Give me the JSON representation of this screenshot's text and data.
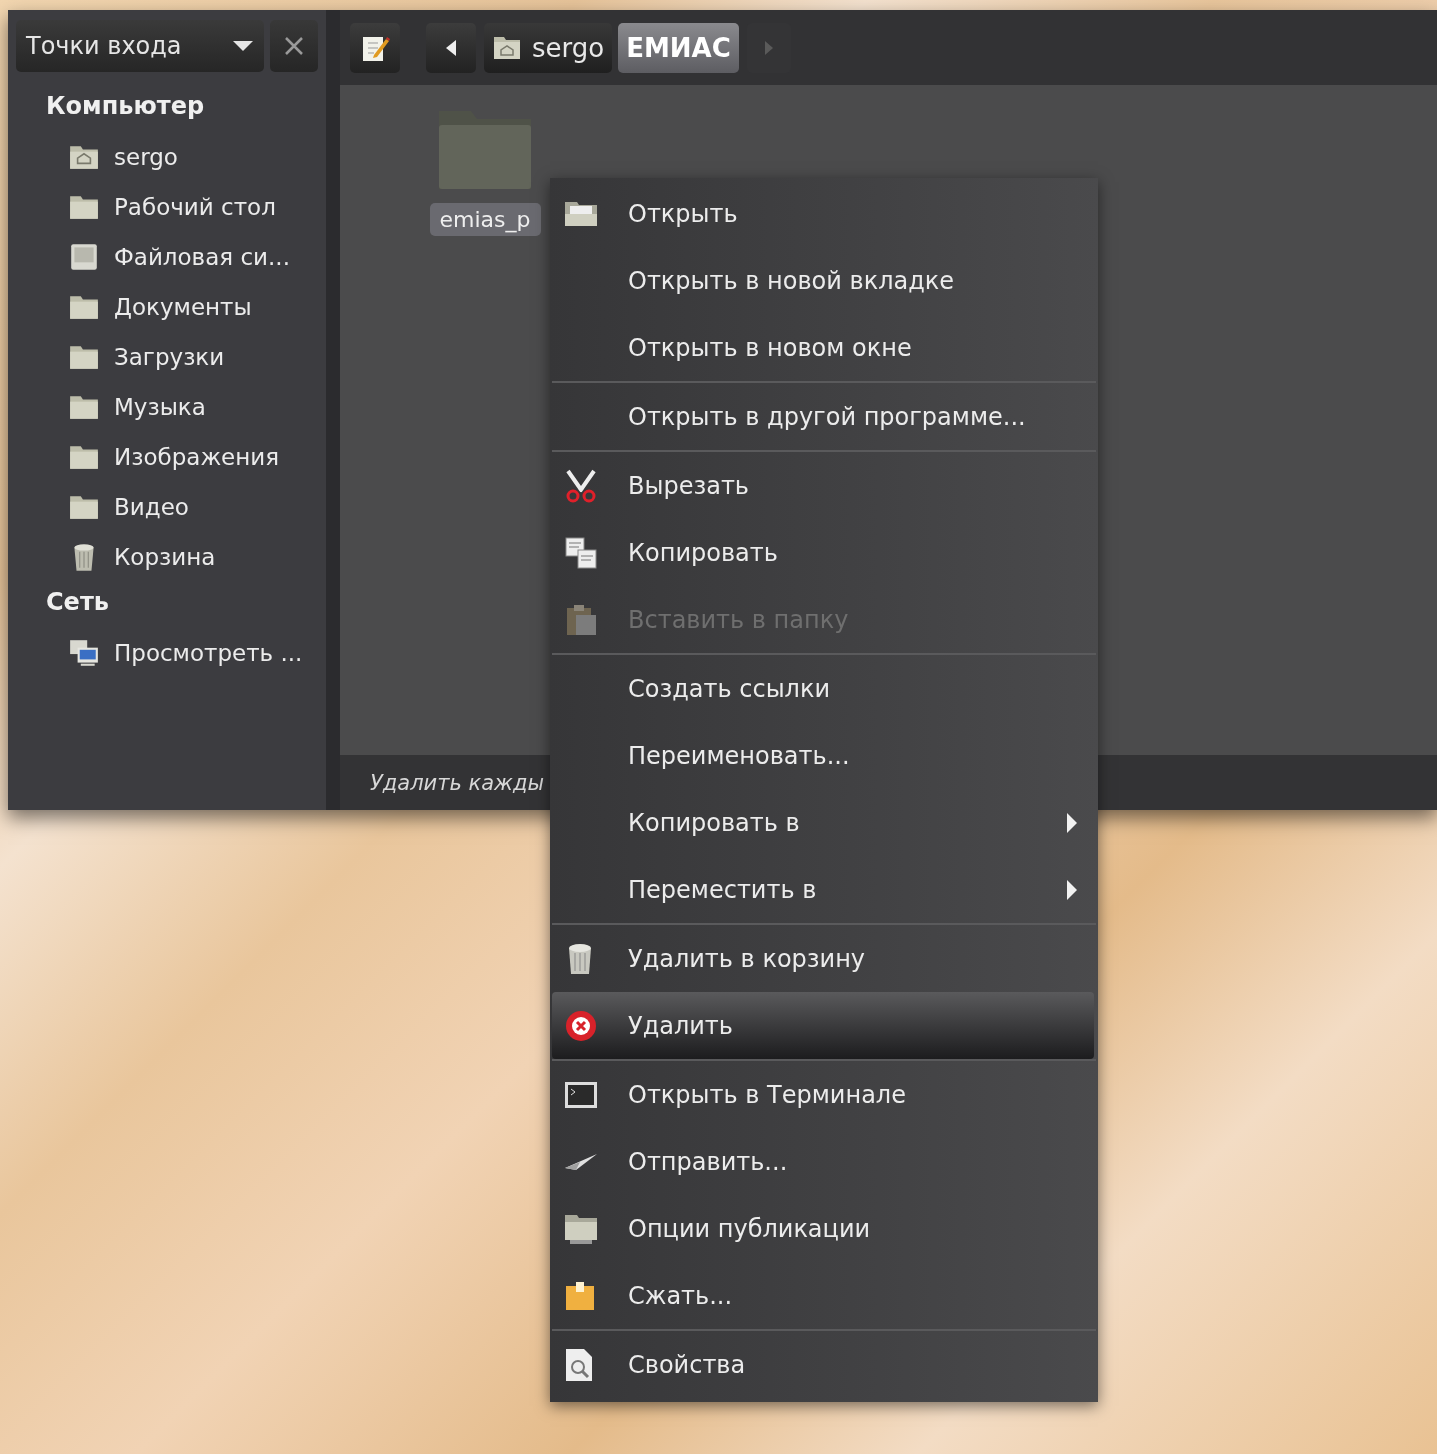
{
  "sidebar": {
    "places_dropdown": {
      "label": "Точки входа"
    },
    "sections": [
      {
        "title": "Компьютер",
        "items": [
          {
            "label": "sergo"
          },
          {
            "label": "Рабочий стол"
          },
          {
            "label": "Файловая си..."
          },
          {
            "label": "Документы"
          },
          {
            "label": "Загрузки"
          },
          {
            "label": "Музыка"
          },
          {
            "label": "Изображения"
          },
          {
            "label": "Видео"
          },
          {
            "label": "Корзина"
          }
        ]
      },
      {
        "title": "Сеть",
        "items": [
          {
            "label": "Просмотреть ..."
          }
        ]
      }
    ]
  },
  "toolbar": {
    "path": [
      {
        "label": "sergo",
        "selected": false
      },
      {
        "label": "ЕМИАС",
        "selected": true
      }
    ],
    "forward_disabled": true
  },
  "files": [
    {
      "name": "emias_p",
      "selected": true
    }
  ],
  "status_bar": {
    "text": "Удалить кажды"
  },
  "context_menu": [
    {
      "kind": "item",
      "label": "Открыть",
      "disabled": false,
      "selected": false,
      "submenu": false
    },
    {
      "kind": "item",
      "label": "Открыть в новой вкладке",
      "disabled": false,
      "selected": false,
      "submenu": false
    },
    {
      "kind": "item",
      "label": "Открыть в новом окне",
      "disabled": false,
      "selected": false,
      "submenu": false
    },
    {
      "kind": "separator"
    },
    {
      "kind": "item",
      "label": "Открыть в другой программе...",
      "disabled": false,
      "selected": false,
      "submenu": false
    },
    {
      "kind": "separator"
    },
    {
      "kind": "item",
      "label": "Вырезать",
      "disabled": false,
      "selected": false,
      "submenu": false
    },
    {
      "kind": "item",
      "label": "Копировать",
      "disabled": false,
      "selected": false,
      "submenu": false
    },
    {
      "kind": "item",
      "label": "Вставить в папку",
      "disabled": true,
      "selected": false,
      "submenu": false
    },
    {
      "kind": "separator"
    },
    {
      "kind": "item",
      "label": "Создать ссылки",
      "disabled": false,
      "selected": false,
      "submenu": false
    },
    {
      "kind": "item",
      "label": "Переименовать...",
      "disabled": false,
      "selected": false,
      "submenu": false
    },
    {
      "kind": "item",
      "label": "Копировать в",
      "disabled": false,
      "selected": false,
      "submenu": true
    },
    {
      "kind": "item",
      "label": "Переместить в",
      "disabled": false,
      "selected": false,
      "submenu": true
    },
    {
      "kind": "separator"
    },
    {
      "kind": "item",
      "label": "Удалить в корзину",
      "disabled": false,
      "selected": false,
      "submenu": false
    },
    {
      "kind": "item",
      "label": "Удалить",
      "disabled": false,
      "selected": true,
      "submenu": false
    },
    {
      "kind": "separator"
    },
    {
      "kind": "item",
      "label": "Открыть в Терминале",
      "disabled": false,
      "selected": false,
      "submenu": false
    },
    {
      "kind": "item",
      "label": "Отправить...",
      "disabled": false,
      "selected": false,
      "submenu": false
    },
    {
      "kind": "item",
      "label": "Опции публикации",
      "disabled": false,
      "selected": false,
      "submenu": false
    },
    {
      "kind": "item",
      "label": "Сжать...",
      "disabled": false,
      "selected": false,
      "submenu": false
    },
    {
      "kind": "separator"
    },
    {
      "kind": "item",
      "label": "Свойства",
      "disabled": false,
      "selected": false,
      "submenu": false
    }
  ]
}
